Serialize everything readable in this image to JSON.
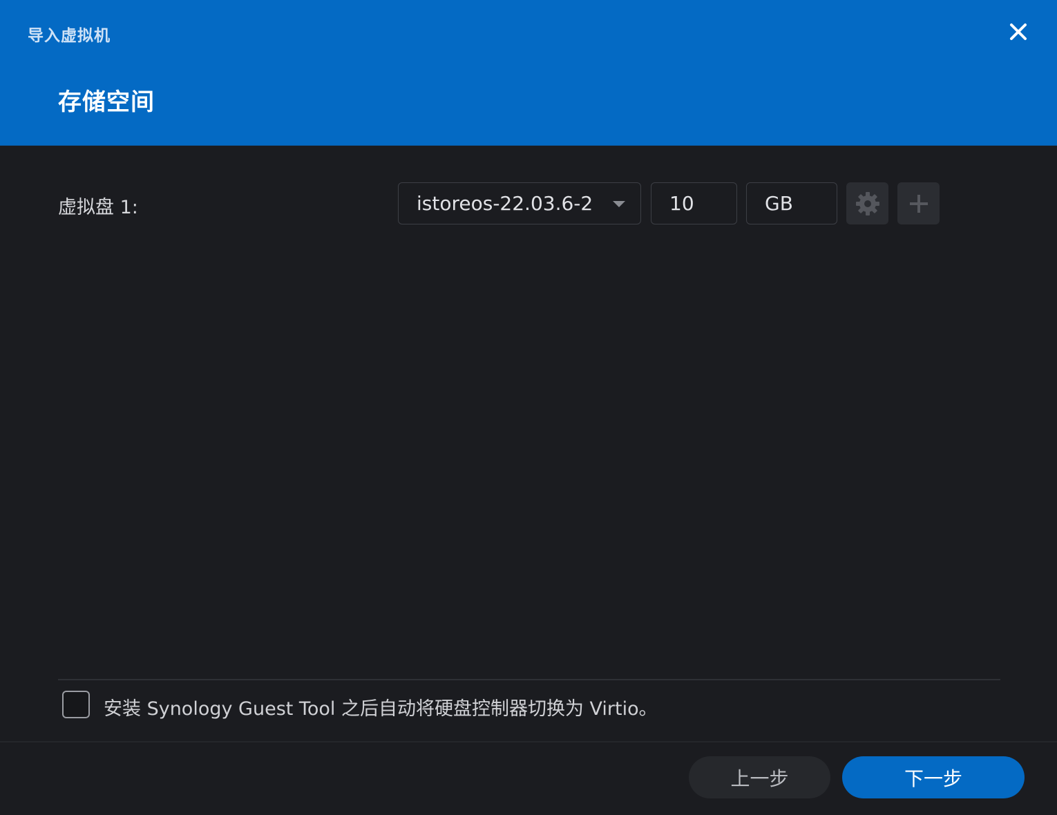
{
  "header": {
    "window_title": "导入虚拟机",
    "step_title": "存储空间",
    "close_icon": "close-icon"
  },
  "disk": {
    "label": "虚拟盘 1:",
    "image_value": "istoreos-22.03.6-2",
    "size_value": "10",
    "unit_value": "GB",
    "settings_icon": "gear-icon",
    "add_icon": "plus-icon"
  },
  "option": {
    "checked": false,
    "label": "安装 Synology Guest Tool 之后自动将硬盘控制器切换为 Virtio。"
  },
  "footer": {
    "prev_label": "上一步",
    "next_label": "下一步"
  },
  "colors": {
    "header_bg": "#046ac4",
    "body_bg": "#1b1c20",
    "primary_button": "#046ac4",
    "secondary_button": "#26282c"
  }
}
